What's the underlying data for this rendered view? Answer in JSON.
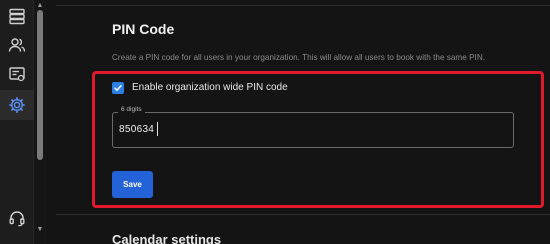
{
  "sidebar": {
    "items": [
      {
        "icon": "server-list-icon",
        "active": false
      },
      {
        "icon": "users-icon",
        "active": false
      },
      {
        "icon": "booking-screen-icon",
        "active": false
      },
      {
        "icon": "gear-icon",
        "active": true
      },
      {
        "icon": "headset-icon",
        "active": false
      }
    ]
  },
  "pin_section": {
    "title": "PIN Code",
    "description": "Create a PIN code for all users in your organization. This will allow all users to book with the same PIN.",
    "enable_checkbox": {
      "label": "Enable organization wide PIN code",
      "checked": true
    },
    "pin_input": {
      "legend": "6 digits",
      "value": "850634"
    },
    "save_label": "Save"
  },
  "next_section": {
    "title": "Calendar settings"
  },
  "colors": {
    "accent": "#2462d8",
    "checkbox": "#2c7fe0",
    "highlight": "#e01a2c"
  }
}
